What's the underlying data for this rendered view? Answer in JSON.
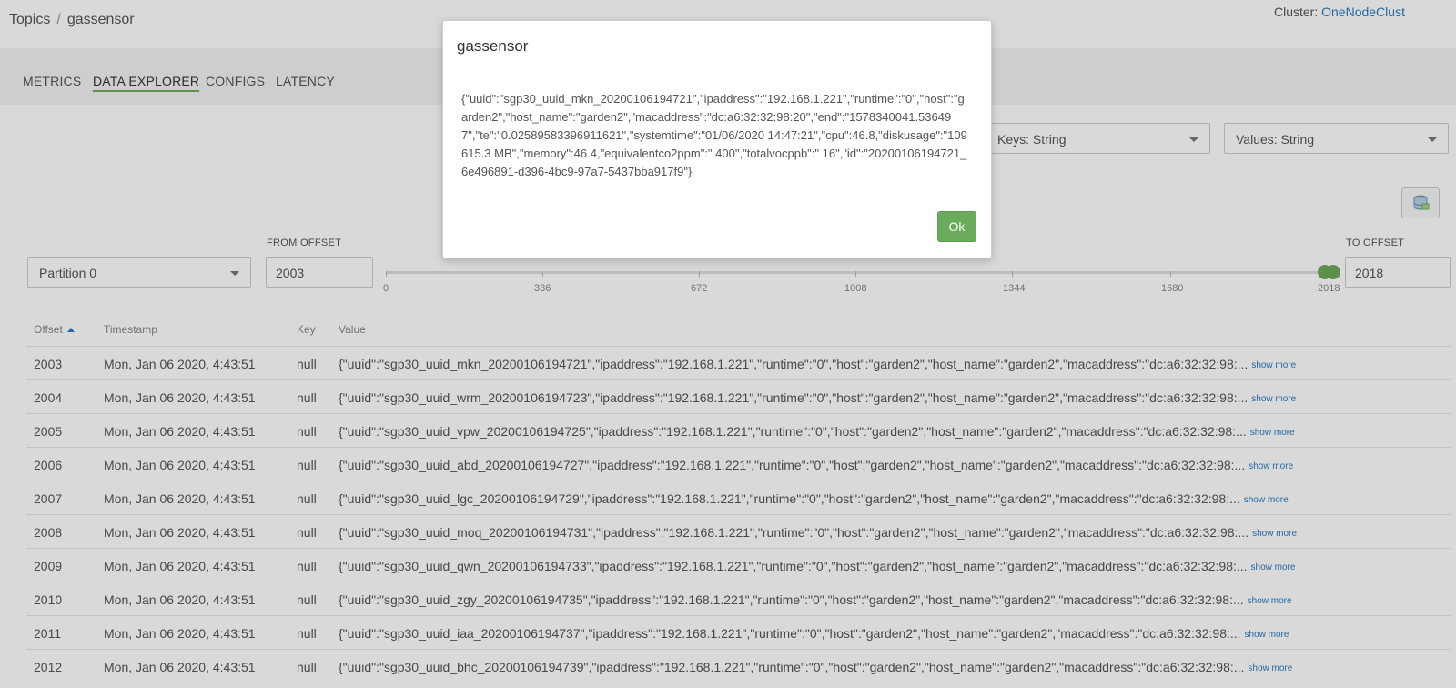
{
  "breadcrumb": {
    "root": "Topics",
    "separator": "/",
    "current": "gassensor"
  },
  "cluster": {
    "label": "Cluster:",
    "name": "OneNodeClust"
  },
  "tabs": [
    "METRICS",
    "DATA EXPLORER",
    "CONFIGS",
    "LATENCY"
  ],
  "active_tab": "DATA EXPLORER",
  "controls": {
    "keys_select": "Keys: String",
    "values_select": "Values: String",
    "partition_select": "Partition 0",
    "from_offset_label": "FROM OFFSET",
    "from_offset": "2003",
    "to_offset_label": "TO OFFSET",
    "to_offset": "2018",
    "slider_ticks": [
      "0",
      "336",
      "672",
      "1008",
      "1344",
      "1680",
      "2018"
    ],
    "slider_range": {
      "min": 0,
      "max": 2018,
      "from": 2003,
      "to": 2018
    }
  },
  "table": {
    "headers": [
      "Offset",
      "Timestamp",
      "Key",
      "Value"
    ],
    "sort_column": "Offset",
    "show_more_label": "show more",
    "rows": [
      {
        "offset": "2003",
        "timestamp": "Mon, Jan 06 2020, 4:43:51",
        "key": "null",
        "value": "{\"uuid\":\"sgp30_uuid_mkn_20200106194721\",\"ipaddress\":\"192.168.1.221\",\"runtime\":\"0\",\"host\":\"garden2\",\"host_name\":\"garden2\",\"macaddress\":\"dc:a6:32:32:98:..."
      },
      {
        "offset": "2004",
        "timestamp": "Mon, Jan 06 2020, 4:43:51",
        "key": "null",
        "value": "{\"uuid\":\"sgp30_uuid_wrm_20200106194723\",\"ipaddress\":\"192.168.1.221\",\"runtime\":\"0\",\"host\":\"garden2\",\"host_name\":\"garden2\",\"macaddress\":\"dc:a6:32:32:98:..."
      },
      {
        "offset": "2005",
        "timestamp": "Mon, Jan 06 2020, 4:43:51",
        "key": "null",
        "value": "{\"uuid\":\"sgp30_uuid_vpw_20200106194725\",\"ipaddress\":\"192.168.1.221\",\"runtime\":\"0\",\"host\":\"garden2\",\"host_name\":\"garden2\",\"macaddress\":\"dc:a6:32:32:98:..."
      },
      {
        "offset": "2006",
        "timestamp": "Mon, Jan 06 2020, 4:43:51",
        "key": "null",
        "value": "{\"uuid\":\"sgp30_uuid_abd_20200106194727\",\"ipaddress\":\"192.168.1.221\",\"runtime\":\"0\",\"host\":\"garden2\",\"host_name\":\"garden2\",\"macaddress\":\"dc:a6:32:32:98:..."
      },
      {
        "offset": "2007",
        "timestamp": "Mon, Jan 06 2020, 4:43:51",
        "key": "null",
        "value": "{\"uuid\":\"sgp30_uuid_lgc_20200106194729\",\"ipaddress\":\"192.168.1.221\",\"runtime\":\"0\",\"host\":\"garden2\",\"host_name\":\"garden2\",\"macaddress\":\"dc:a6:32:32:98:..."
      },
      {
        "offset": "2008",
        "timestamp": "Mon, Jan 06 2020, 4:43:51",
        "key": "null",
        "value": "{\"uuid\":\"sgp30_uuid_moq_20200106194731\",\"ipaddress\":\"192.168.1.221\",\"runtime\":\"0\",\"host\":\"garden2\",\"host_name\":\"garden2\",\"macaddress\":\"dc:a6:32:32:98:..."
      },
      {
        "offset": "2009",
        "timestamp": "Mon, Jan 06 2020, 4:43:51",
        "key": "null",
        "value": "{\"uuid\":\"sgp30_uuid_qwn_20200106194733\",\"ipaddress\":\"192.168.1.221\",\"runtime\":\"0\",\"host\":\"garden2\",\"host_name\":\"garden2\",\"macaddress\":\"dc:a6:32:32:98:..."
      },
      {
        "offset": "2010",
        "timestamp": "Mon, Jan 06 2020, 4:43:51",
        "key": "null",
        "value": "{\"uuid\":\"sgp30_uuid_zgy_20200106194735\",\"ipaddress\":\"192.168.1.221\",\"runtime\":\"0\",\"host\":\"garden2\",\"host_name\":\"garden2\",\"macaddress\":\"dc:a6:32:32:98:..."
      },
      {
        "offset": "2011",
        "timestamp": "Mon, Jan 06 2020, 4:43:51",
        "key": "null",
        "value": "{\"uuid\":\"sgp30_uuid_iaa_20200106194737\",\"ipaddress\":\"192.168.1.221\",\"runtime\":\"0\",\"host\":\"garden2\",\"host_name\":\"garden2\",\"macaddress\":\"dc:a6:32:32:98:..."
      },
      {
        "offset": "2012",
        "timestamp": "Mon, Jan 06 2020, 4:43:51",
        "key": "null",
        "value": "{\"uuid\":\"sgp30_uuid_bhc_20200106194739\",\"ipaddress\":\"192.168.1.221\",\"runtime\":\"0\",\"host\":\"garden2\",\"host_name\":\"garden2\",\"macaddress\":\"dc:a6:32:32:98:..."
      }
    ]
  },
  "modal": {
    "title": "gassensor",
    "body": "{\"uuid\":\"sgp30_uuid_mkn_20200106194721\",\"ipaddress\":\"192.168.1.221\",\"runtime\":\"0\",\"host\":\"garden2\",\"host_name\":\"garden2\",\"macaddress\":\"dc:a6:32:32:98:20\",\"end\":\"1578340041.536497\",\"te\":\"0.02589583396911621\",\"systemtime\":\"01/06/2020 14:47:21\",\"cpu\":46.8,\"diskusage\":\"109615.3 MB\",\"memory\":46.4,\"equivalentco2ppm\":\" 400\",\"totalvocppb\":\" 16\",\"id\":\"20200106194721_6e496891-d396-4bc9-97a7-5437bba917f9\"}",
    "ok_label": "Ok"
  },
  "icons": {
    "db_icon": "database-icon",
    "sort_icon": "sort-asc-icon",
    "select_caret": "chevron-down-icon"
  },
  "colors": {
    "accent_green": "#6bab5b",
    "link_blue": "#2a7bc0"
  }
}
